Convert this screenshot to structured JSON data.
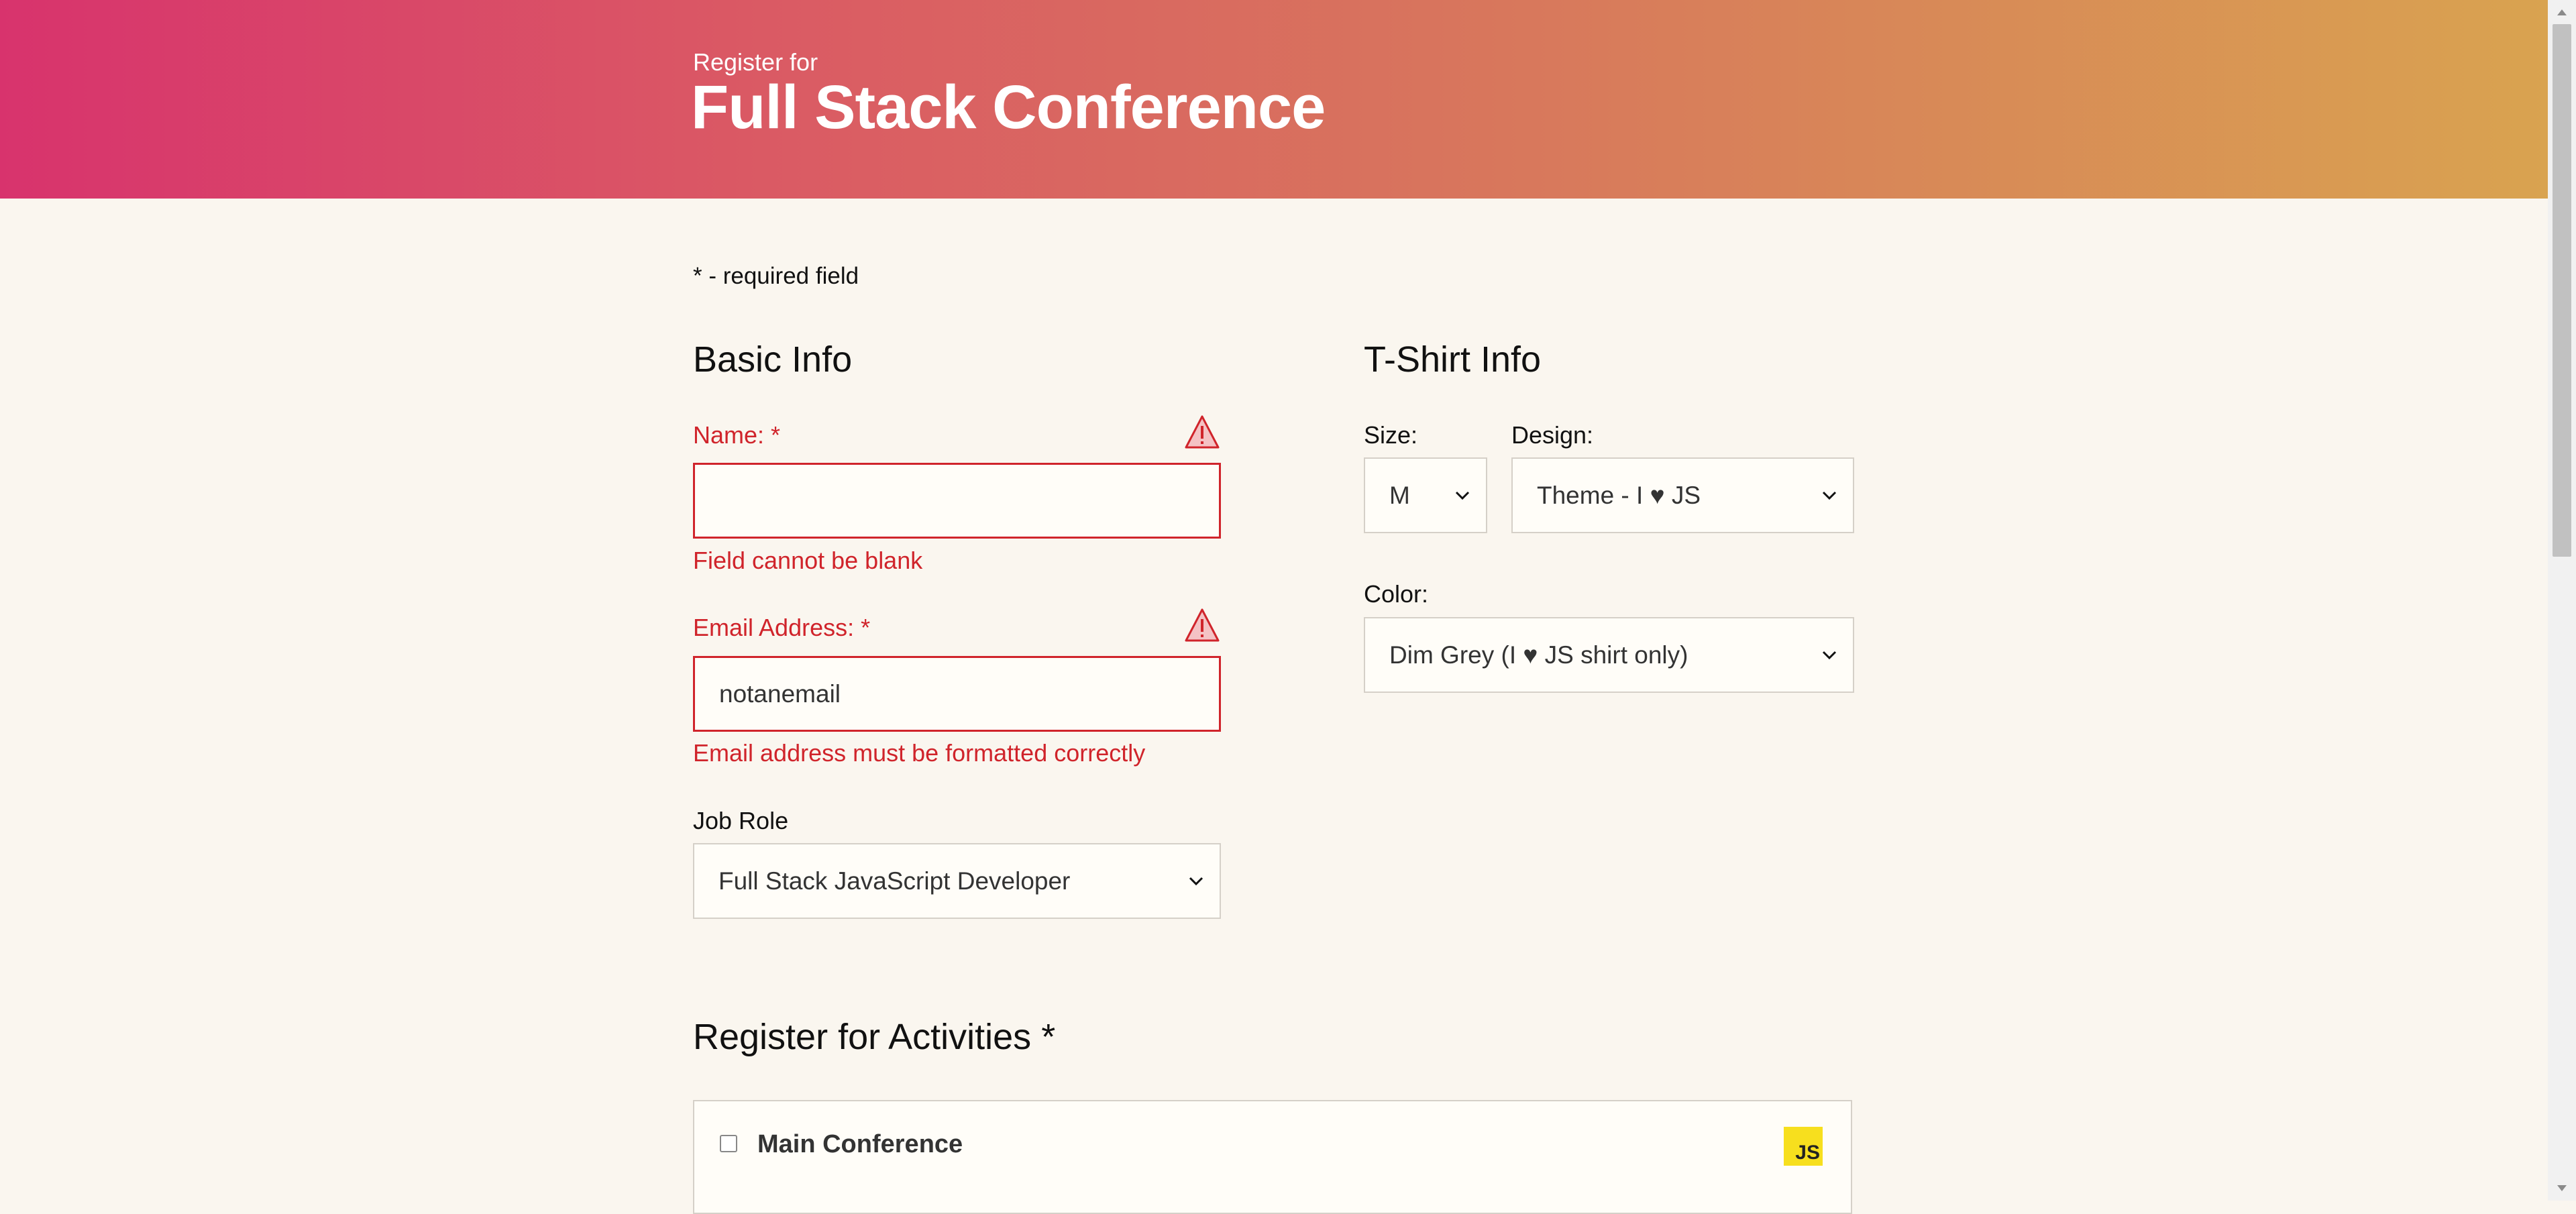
{
  "header": {
    "subtitle": "Register for",
    "title": "Full Stack Conference"
  },
  "required_note": "* - required field",
  "basic_info": {
    "heading": "Basic Info",
    "name": {
      "label": "Name:",
      "star": "*",
      "value": "",
      "error": "Field cannot be blank"
    },
    "email": {
      "label": "Email Address:",
      "star": "*",
      "value": "notanemail",
      "error": "Email address must be formatted correctly"
    },
    "job_role": {
      "label": "Job Role",
      "selected": "Full Stack JavaScript Developer"
    }
  },
  "tshirt": {
    "heading": "T-Shirt Info",
    "size": {
      "label": "Size:",
      "selected": "M"
    },
    "design": {
      "label": "Design:",
      "selected": "Theme - I ♥ JS"
    },
    "color": {
      "label": "Color:",
      "selected": "Dim Grey (I ♥ JS shirt only)"
    }
  },
  "activities": {
    "heading": "Register for Activities",
    "star": "*",
    "items": [
      {
        "title": "Main Conference",
        "badge": "JS"
      }
    ]
  },
  "colors": {
    "error": "#d0242b",
    "header_start": "#d8336d",
    "header_end": "#d9a350",
    "background": "#faf6ef"
  },
  "icons": [
    "warning-icon",
    "chevron-down-icon",
    "js-logo-icon"
  ]
}
